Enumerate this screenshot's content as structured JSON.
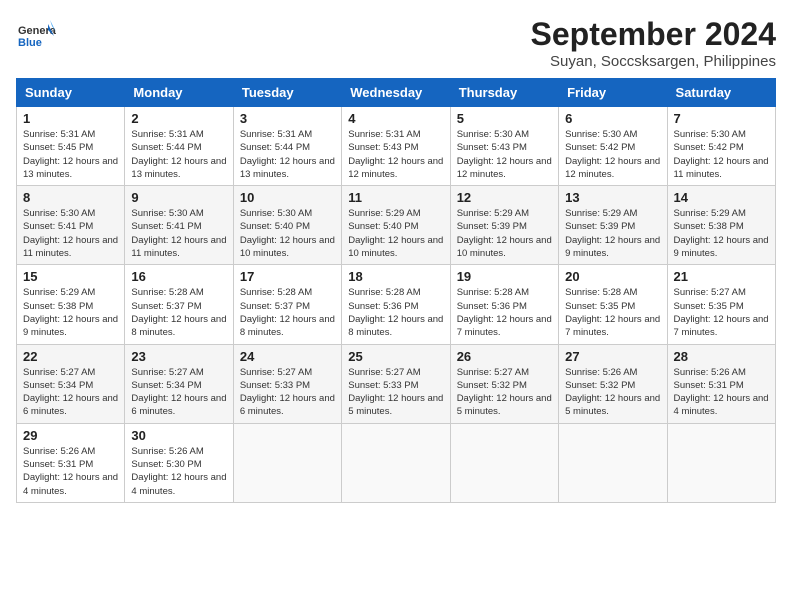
{
  "header": {
    "logo_general": "General",
    "logo_blue": "Blue",
    "month": "September 2024",
    "location": "Suyan, Soccsksargen, Philippines"
  },
  "weekdays": [
    "Sunday",
    "Monday",
    "Tuesday",
    "Wednesday",
    "Thursday",
    "Friday",
    "Saturday"
  ],
  "weeks": [
    [
      {
        "day": "1",
        "sunrise": "Sunrise: 5:31 AM",
        "sunset": "Sunset: 5:45 PM",
        "daylight": "Daylight: 12 hours and 13 minutes."
      },
      {
        "day": "2",
        "sunrise": "Sunrise: 5:31 AM",
        "sunset": "Sunset: 5:44 PM",
        "daylight": "Daylight: 12 hours and 13 minutes."
      },
      {
        "day": "3",
        "sunrise": "Sunrise: 5:31 AM",
        "sunset": "Sunset: 5:44 PM",
        "daylight": "Daylight: 12 hours and 13 minutes."
      },
      {
        "day": "4",
        "sunrise": "Sunrise: 5:31 AM",
        "sunset": "Sunset: 5:43 PM",
        "daylight": "Daylight: 12 hours and 12 minutes."
      },
      {
        "day": "5",
        "sunrise": "Sunrise: 5:30 AM",
        "sunset": "Sunset: 5:43 PM",
        "daylight": "Daylight: 12 hours and 12 minutes."
      },
      {
        "day": "6",
        "sunrise": "Sunrise: 5:30 AM",
        "sunset": "Sunset: 5:42 PM",
        "daylight": "Daylight: 12 hours and 12 minutes."
      },
      {
        "day": "7",
        "sunrise": "Sunrise: 5:30 AM",
        "sunset": "Sunset: 5:42 PM",
        "daylight": "Daylight: 12 hours and 11 minutes."
      }
    ],
    [
      {
        "day": "8",
        "sunrise": "Sunrise: 5:30 AM",
        "sunset": "Sunset: 5:41 PM",
        "daylight": "Daylight: 12 hours and 11 minutes."
      },
      {
        "day": "9",
        "sunrise": "Sunrise: 5:30 AM",
        "sunset": "Sunset: 5:41 PM",
        "daylight": "Daylight: 12 hours and 11 minutes."
      },
      {
        "day": "10",
        "sunrise": "Sunrise: 5:30 AM",
        "sunset": "Sunset: 5:40 PM",
        "daylight": "Daylight: 12 hours and 10 minutes."
      },
      {
        "day": "11",
        "sunrise": "Sunrise: 5:29 AM",
        "sunset": "Sunset: 5:40 PM",
        "daylight": "Daylight: 12 hours and 10 minutes."
      },
      {
        "day": "12",
        "sunrise": "Sunrise: 5:29 AM",
        "sunset": "Sunset: 5:39 PM",
        "daylight": "Daylight: 12 hours and 10 minutes."
      },
      {
        "day": "13",
        "sunrise": "Sunrise: 5:29 AM",
        "sunset": "Sunset: 5:39 PM",
        "daylight": "Daylight: 12 hours and 9 minutes."
      },
      {
        "day": "14",
        "sunrise": "Sunrise: 5:29 AM",
        "sunset": "Sunset: 5:38 PM",
        "daylight": "Daylight: 12 hours and 9 minutes."
      }
    ],
    [
      {
        "day": "15",
        "sunrise": "Sunrise: 5:29 AM",
        "sunset": "Sunset: 5:38 PM",
        "daylight": "Daylight: 12 hours and 9 minutes."
      },
      {
        "day": "16",
        "sunrise": "Sunrise: 5:28 AM",
        "sunset": "Sunset: 5:37 PM",
        "daylight": "Daylight: 12 hours and 8 minutes."
      },
      {
        "day": "17",
        "sunrise": "Sunrise: 5:28 AM",
        "sunset": "Sunset: 5:37 PM",
        "daylight": "Daylight: 12 hours and 8 minutes."
      },
      {
        "day": "18",
        "sunrise": "Sunrise: 5:28 AM",
        "sunset": "Sunset: 5:36 PM",
        "daylight": "Daylight: 12 hours and 8 minutes."
      },
      {
        "day": "19",
        "sunrise": "Sunrise: 5:28 AM",
        "sunset": "Sunset: 5:36 PM",
        "daylight": "Daylight: 12 hours and 7 minutes."
      },
      {
        "day": "20",
        "sunrise": "Sunrise: 5:28 AM",
        "sunset": "Sunset: 5:35 PM",
        "daylight": "Daylight: 12 hours and 7 minutes."
      },
      {
        "day": "21",
        "sunrise": "Sunrise: 5:27 AM",
        "sunset": "Sunset: 5:35 PM",
        "daylight": "Daylight: 12 hours and 7 minutes."
      }
    ],
    [
      {
        "day": "22",
        "sunrise": "Sunrise: 5:27 AM",
        "sunset": "Sunset: 5:34 PM",
        "daylight": "Daylight: 12 hours and 6 minutes."
      },
      {
        "day": "23",
        "sunrise": "Sunrise: 5:27 AM",
        "sunset": "Sunset: 5:34 PM",
        "daylight": "Daylight: 12 hours and 6 minutes."
      },
      {
        "day": "24",
        "sunrise": "Sunrise: 5:27 AM",
        "sunset": "Sunset: 5:33 PM",
        "daylight": "Daylight: 12 hours and 6 minutes."
      },
      {
        "day": "25",
        "sunrise": "Sunrise: 5:27 AM",
        "sunset": "Sunset: 5:33 PM",
        "daylight": "Daylight: 12 hours and 5 minutes."
      },
      {
        "day": "26",
        "sunrise": "Sunrise: 5:27 AM",
        "sunset": "Sunset: 5:32 PM",
        "daylight": "Daylight: 12 hours and 5 minutes."
      },
      {
        "day": "27",
        "sunrise": "Sunrise: 5:26 AM",
        "sunset": "Sunset: 5:32 PM",
        "daylight": "Daylight: 12 hours and 5 minutes."
      },
      {
        "day": "28",
        "sunrise": "Sunrise: 5:26 AM",
        "sunset": "Sunset: 5:31 PM",
        "daylight": "Daylight: 12 hours and 4 minutes."
      }
    ],
    [
      {
        "day": "29",
        "sunrise": "Sunrise: 5:26 AM",
        "sunset": "Sunset: 5:31 PM",
        "daylight": "Daylight: 12 hours and 4 minutes."
      },
      {
        "day": "30",
        "sunrise": "Sunrise: 5:26 AM",
        "sunset": "Sunset: 5:30 PM",
        "daylight": "Daylight: 12 hours and 4 minutes."
      },
      null,
      null,
      null,
      null,
      null
    ]
  ]
}
